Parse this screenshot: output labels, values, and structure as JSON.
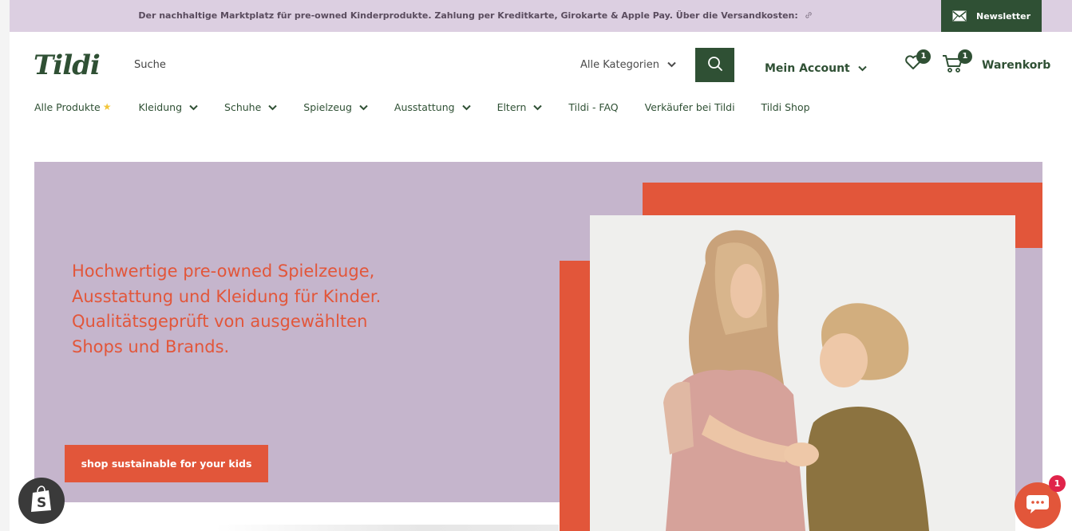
{
  "announcement": {
    "text": "Der nachhaltige Marktplatz für pre-owned Kinderprodukte. Zahlung per Kreditkarte, Girokarte & Apple Pay. Über die Versandkosten:",
    "link_icon": "link-icon",
    "newsletter_label": "Newsletter",
    "newsletter_icon": "mail-icon"
  },
  "header": {
    "logo": "Tildi",
    "search_placeholder": "Suche",
    "category_select": "Alle Kategorien",
    "search_icon": "search-icon",
    "account_label": "Mein Account",
    "wishlist_count": "1",
    "cart_count": "1",
    "cart_label": "Warenkorb"
  },
  "nav": {
    "items": [
      {
        "label": "Alle Produkte",
        "has_dropdown": false,
        "icon": "star-icon"
      },
      {
        "label": "Kleidung",
        "has_dropdown": true
      },
      {
        "label": "Schuhe",
        "has_dropdown": true
      },
      {
        "label": "Spielzeug",
        "has_dropdown": true
      },
      {
        "label": "Ausstattung",
        "has_dropdown": true
      },
      {
        "label": "Eltern",
        "has_dropdown": true
      },
      {
        "label": "Tildi - FAQ",
        "has_dropdown": false
      },
      {
        "label": "Verkäufer bei Tildi",
        "has_dropdown": false
      },
      {
        "label": "Tildi Shop",
        "has_dropdown": false
      }
    ]
  },
  "hero": {
    "headline_lines": [
      "Hochwertige pre-owned Spielzeuge,",
      "Ausstattung und Kleidung für Kinder.",
      "Qualitätsgeprüft von ausgewählten",
      "Shops und Brands."
    ],
    "cta_label": "shop sustainable for your kids"
  },
  "floating": {
    "chat_badge": "1"
  },
  "colors": {
    "brand_green": "#2f5034",
    "announcement_bg": "#dccfe1",
    "hero_bg": "#c5b5cc",
    "accent_orange": "#e2563a"
  }
}
